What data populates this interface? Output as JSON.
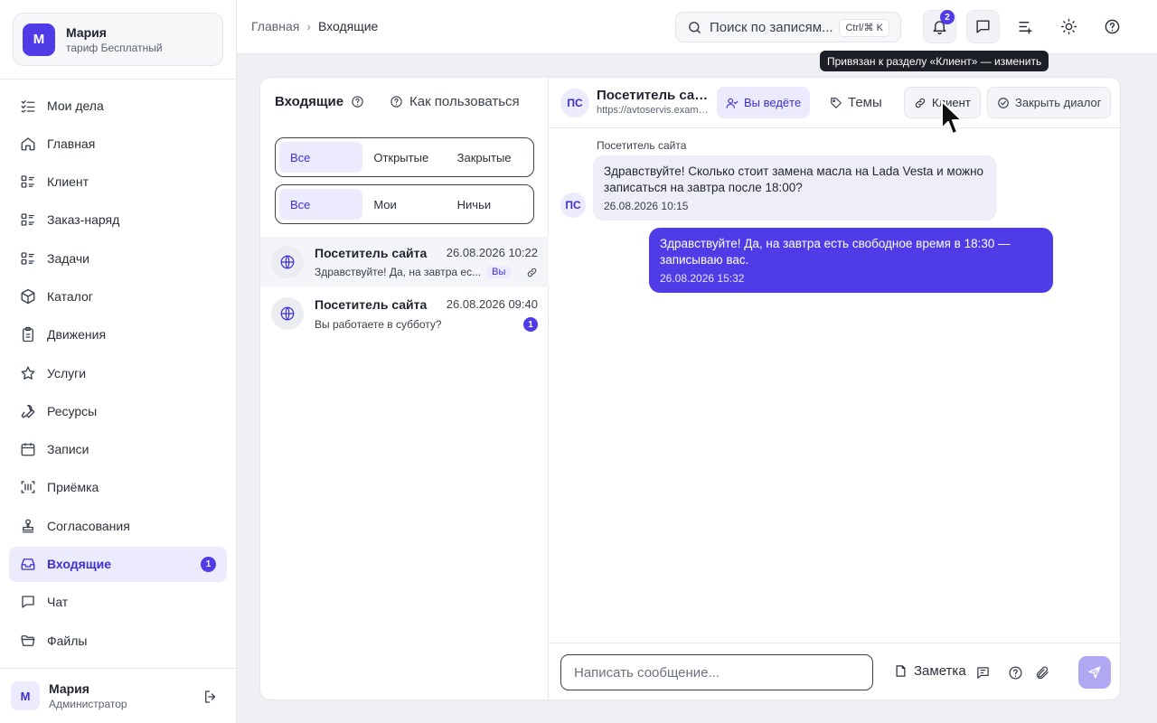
{
  "org": {
    "avatar_letter": "М",
    "name": "Мария",
    "plan": "тариф Бесплатный"
  },
  "nav": [
    {
      "label": "Мои дела",
      "icon": "checklist-icon"
    },
    {
      "label": "Главная",
      "icon": "home-icon"
    },
    {
      "label": "Клиент",
      "icon": "list-icon"
    },
    {
      "label": "Заказ-наряд",
      "icon": "list-icon"
    },
    {
      "label": "Задачи",
      "icon": "list-icon"
    },
    {
      "label": "Каталог",
      "icon": "box-icon"
    },
    {
      "label": "Движения",
      "icon": "clipboard-icon"
    },
    {
      "label": "Услуги",
      "icon": "star-icon"
    },
    {
      "label": "Ресурсы",
      "icon": "wrench-icon"
    },
    {
      "label": "Записи",
      "icon": "calendar-icon"
    },
    {
      "label": "Приёмка",
      "icon": "scan-icon"
    },
    {
      "label": "Согласования",
      "icon": "stamp-icon"
    },
    {
      "label": "Входящие",
      "icon": "inbox-icon",
      "badge": "1"
    },
    {
      "label": "Чат",
      "icon": "chat-icon"
    },
    {
      "label": "Файлы",
      "icon": "folder-icon"
    }
  ],
  "user": {
    "avatar_letter": "М",
    "name": "Мария",
    "role": "Администратор"
  },
  "breadcrumb": {
    "root": "Главная",
    "current": "Входящие"
  },
  "search": {
    "placeholder": "Поиск по записям...",
    "shortcut": "Ctrl/⌘ K"
  },
  "notifications": {
    "count": "2"
  },
  "inbox": {
    "title": "Входящие",
    "howto": "Как пользоваться",
    "status_filter": [
      "Все",
      "Открытые",
      "Закрытые"
    ],
    "owner_filter": [
      "Все",
      "Мои",
      "Ничьи"
    ],
    "conversations": [
      {
        "name": "Посетитель сайта",
        "time": "26.08.2026 10:22",
        "snippet": "Здравствуйте! Да, на завтра ес...",
        "tag": "Вы"
      },
      {
        "name": "Посетитель сайта",
        "time": "26.08.2026 09:40",
        "snippet": "Вы работаете в субботу?",
        "unread": "1"
      }
    ]
  },
  "chat": {
    "avatar_initials": "ПС",
    "name": "Посетитель сайта",
    "url": "https://avtoservis.example.ru",
    "buttons": {
      "assignee": "Вы ведёте",
      "topics": "Темы",
      "client": "Клиент",
      "close": "Закрыть диалог"
    },
    "tooltip": "Привязан к разделу «Клиент» — изменить",
    "messages": [
      {
        "direction": "in",
        "sender": "Посетитель сайта",
        "text": "Здравствуйте! Сколько стоит замена масла на Lada Vesta и можно записаться на завтра после 18:00?",
        "time": "26.08.2026 10:15"
      },
      {
        "direction": "out",
        "text": "Здравствуйте! Да, на завтра есть свободное время в 18:30 — записываю вас.",
        "time": "26.08.2026 15:32"
      }
    ],
    "composer": {
      "placeholder": "Написать сообщение...",
      "note_label": "Заметка"
    }
  },
  "colors": {
    "accent": "#4f3ce6",
    "accent_soft": "#ecebfd",
    "send_disabled": "#b0a8f3"
  }
}
